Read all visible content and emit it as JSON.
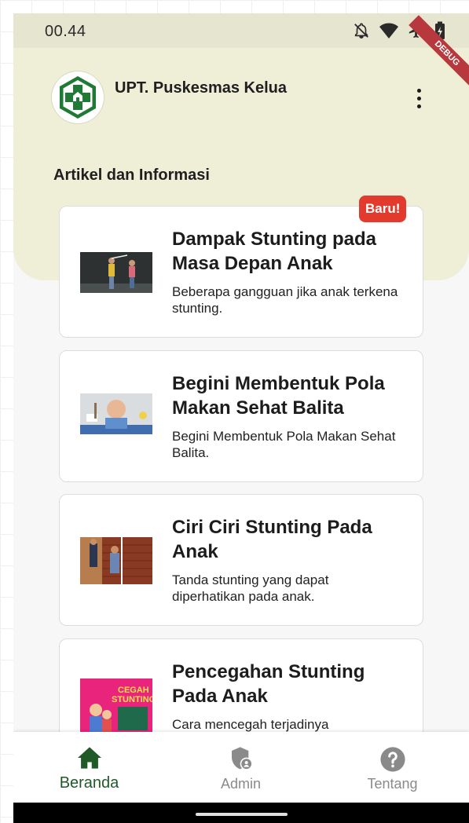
{
  "status_bar": {
    "time": "00.44",
    "icons": [
      "notifications-off-icon",
      "wifi-icon",
      "airplane-icon",
      "battery-charging-icon"
    ]
  },
  "debug_banner": "DEBUG",
  "header": {
    "app_title": "UPT. Puskesmas Kelua",
    "logo_icon": "puskesmas-logo-icon",
    "menu_icon": "more-vert-icon",
    "background_color": "#efeed6"
  },
  "section_title": "Artikel dan Informasi",
  "badge_label": "Baru!",
  "articles": [
    {
      "title": "Dampak Stunting pada Masa Depan Anak",
      "description": "Beberapa gangguan jika anak terkena stunting."
    },
    {
      "title": "Begini Membentuk Pola Makan Sehat Balita",
      "description": "Begini Membentuk Pola Makan Sehat Balita."
    },
    {
      "title": "Ciri Ciri Stunting Pada Anak",
      "description": "Tanda stunting yang dapat diperhatikan pada anak."
    },
    {
      "title": "Pencegahan Stunting Pada Anak",
      "description": "Cara mencegah terjadinya"
    }
  ],
  "thumb_text": {
    "line1": "CEGAH",
    "line2": "STUNTING"
  },
  "bottom_nav": {
    "items": [
      {
        "label": "Beranda",
        "icon": "home-icon",
        "active": true
      },
      {
        "label": "Admin",
        "icon": "admin-shield-icon",
        "active": false
      },
      {
        "label": "Tentang",
        "icon": "help-icon",
        "active": false
      }
    ],
    "active_color": "#1f5a28",
    "inactive_color": "#8a8a8a"
  }
}
